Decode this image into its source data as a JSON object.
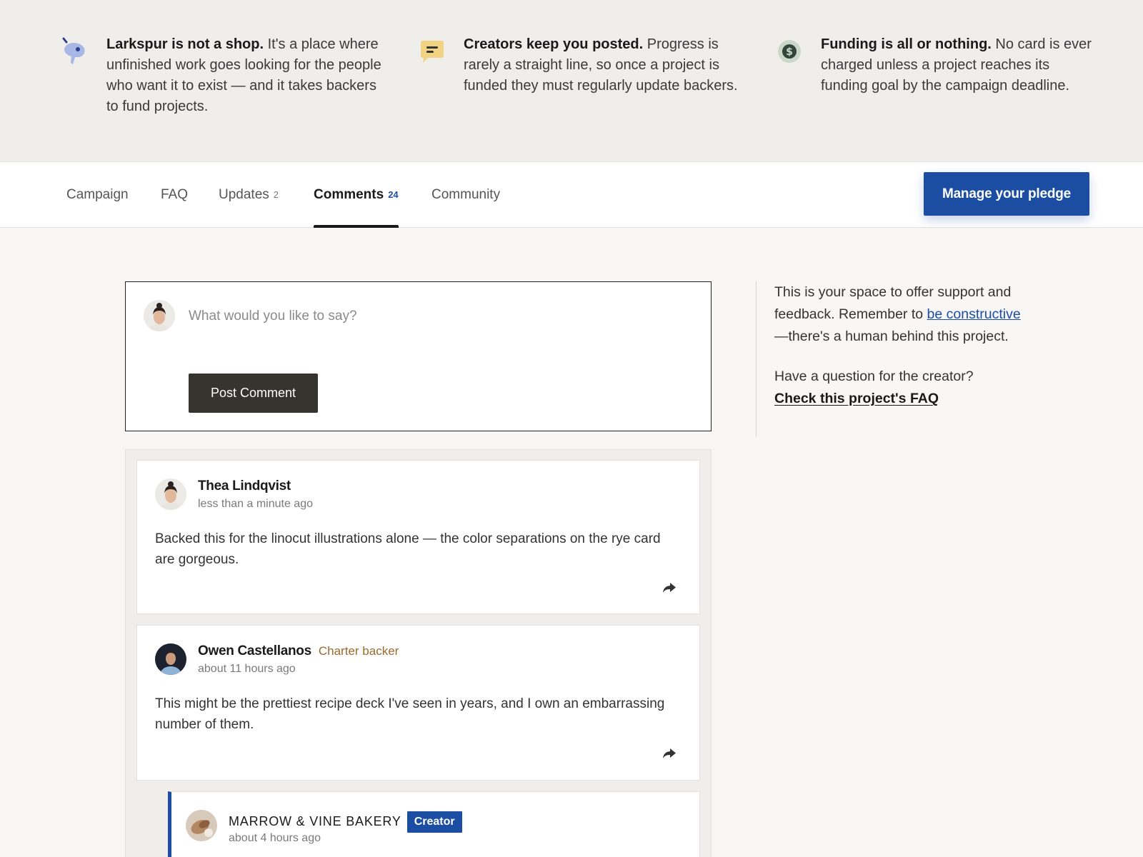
{
  "banner": {
    "items": [
      {
        "icon": "megaphone-icon",
        "bold": "Larkspur is not a shop.",
        "text": " It's a place where unfinished work goes looking for the people who want it to exist — and it takes backers to fund projects."
      },
      {
        "icon": "chat-bubble-icon",
        "bold": "Creators keep you posted.",
        "text": " Progress is rarely a straight line, so once a project is funded they must regularly update backers."
      },
      {
        "icon": "dollar-shield-icon",
        "bold": "Funding is all or nothing.",
        "text": " No card is ever charged unless a project reaches its funding goal by the campaign deadline."
      }
    ]
  },
  "tabs": [
    {
      "label": "Campaign",
      "count": ""
    },
    {
      "label": "FAQ",
      "count": ""
    },
    {
      "label": "Updates",
      "count": "2"
    },
    {
      "label": "Comments",
      "count": "24"
    },
    {
      "label": "Community",
      "count": ""
    }
  ],
  "pledge_button": "Manage your pledge",
  "composer": {
    "placeholder": "What would you like to say?",
    "post_label": "Post Comment"
  },
  "comments": [
    {
      "name": "Thea Lindqvist",
      "badge": "",
      "time": "less than a minute ago",
      "body": "Backed this for the linocut illustrations alone — the color separations on the rye card are gorgeous."
    },
    {
      "name": "Owen Castellanos",
      "badge": "Charter backer",
      "time": "about 11 hours ago",
      "body": "This might be the prettiest recipe deck I've seen in years, and I own an embarrassing number of them."
    },
    {
      "name": "MARROW & VINE BAKERY",
      "badge": "Creator",
      "time": "about 4 hours ago",
      "body": ""
    }
  ],
  "sidenote": {
    "p1_before": "This is your space to offer support and feedback. Remember to ",
    "p1_link": "be constructive",
    "p1_after": "—there's a human behind this project.",
    "p2_text": "Have a question for the creator?",
    "p2_link": "Check this project's FAQ"
  },
  "colors": {
    "accent": "#1b4ea2",
    "charter_badge": "#9a6a2e",
    "post_button": "#37332f"
  }
}
